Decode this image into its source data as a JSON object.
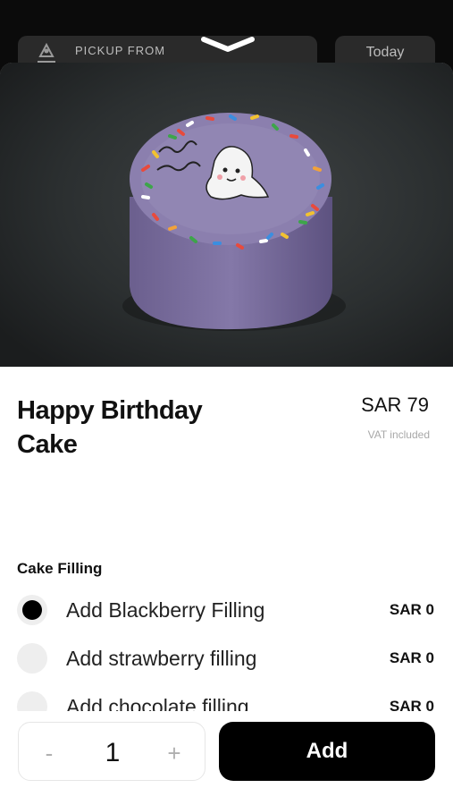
{
  "header": {
    "pickup_label": "PICKUP FROM",
    "day_label": "Today"
  },
  "product": {
    "title": "Happy Birthday Cake",
    "price": "SAR 79",
    "vat_note": "VAT included",
    "image_icon": "cake-photo"
  },
  "filling": {
    "section_title": "Cake Filling",
    "options": [
      {
        "label": "Add Blackberry Filling",
        "price": "SAR 0",
        "selected": true
      },
      {
        "label": "Add strawberry filling",
        "price": "SAR 0",
        "selected": false
      },
      {
        "label": "Add chocolate filling",
        "price": "SAR 0",
        "selected": false
      }
    ]
  },
  "cart": {
    "minus": "-",
    "quantity": "1",
    "plus": "+",
    "add_label": "Add"
  },
  "colors": {
    "accent": "#000000",
    "cake_frosting": "#7a6e9e"
  }
}
